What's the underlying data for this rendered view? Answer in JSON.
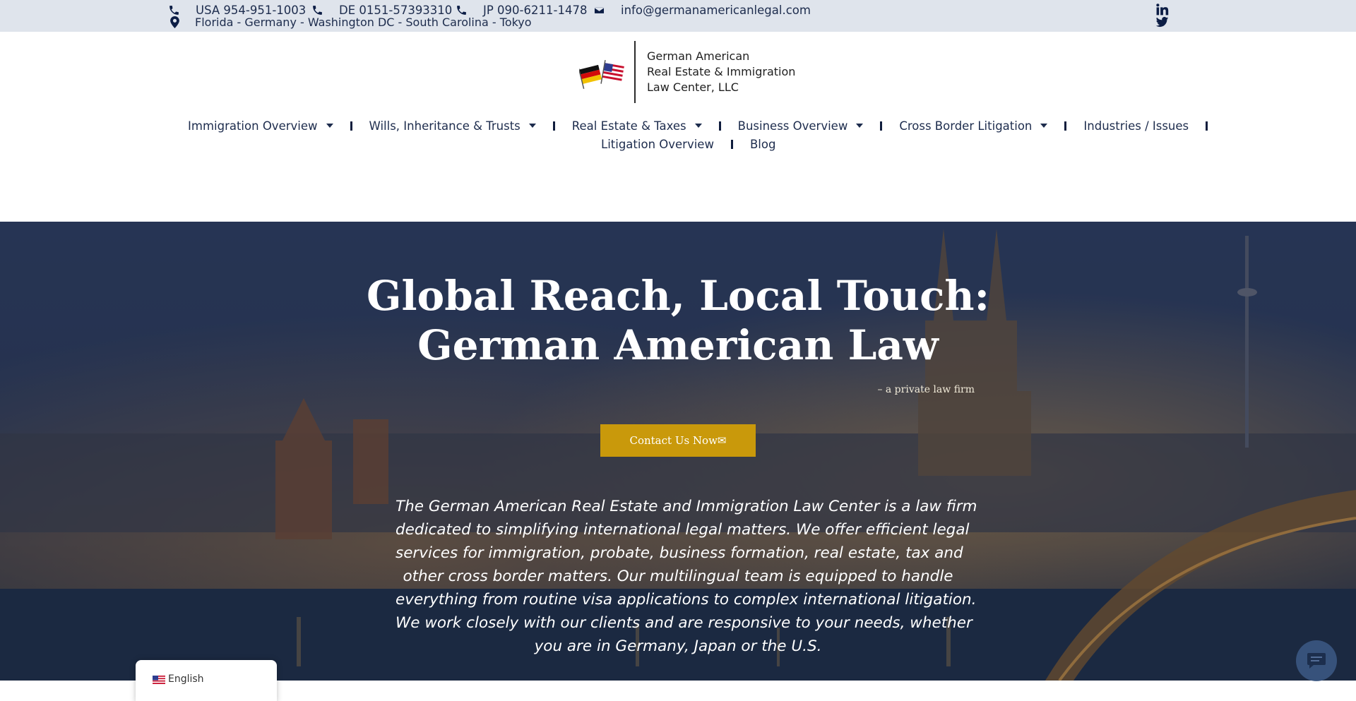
{
  "topbar": {
    "phone_usa": "USA 954-951-1003",
    "phone_de": "DE 0151-57393310",
    "phone_jp": "JP 090-6211-1478",
    "email": "info@germanamericanlegal.com",
    "locations": "Florida - Germany - Washington DC - South Carolina - Tokyo",
    "social": [
      "linkedin-icon",
      "twitter-icon"
    ]
  },
  "logo": {
    "line1": "German American",
    "line2": "Real Estate & Immigration",
    "line3": "Law Center, LLC"
  },
  "nav": {
    "items": [
      {
        "label": "Immigration Overview",
        "dropdown": true
      },
      {
        "label": "Wills, Inheritance & Trusts",
        "dropdown": true
      },
      {
        "label": "Real Estate & Taxes",
        "dropdown": true
      },
      {
        "label": "Business Overview",
        "dropdown": true
      },
      {
        "label": "Cross Border Litigation",
        "dropdown": true
      },
      {
        "label": "Industries / Issues",
        "dropdown": false
      },
      {
        "label": "Litigation Overview",
        "dropdown": false
      },
      {
        "label": "Blog",
        "dropdown": false
      }
    ]
  },
  "hero": {
    "title_line1": "Global Reach, Local Touch:",
    "title_line2": "German American Law",
    "tagline": "– a private law firm",
    "cta_label": "Contact Us Now✉",
    "body_lines": [
      "The German American Real Estate and Immigration Law Center is a law firm",
      "dedicated to simplifying international legal matters. We offer efficient legal",
      "services for immigration, probate, business formation, real estate, tax and",
      "other cross border matters. Our multilingual team is equipped to handle",
      "everything from routine visa applications to complex international litigation.",
      "We work closely with our clients and are responsive to your needs, whether",
      "you are in Germany, Japan or the U.S."
    ]
  },
  "language_switcher": {
    "label": "English",
    "flag": "us-flag-icon"
  },
  "chat": {
    "icon": "chat-icon"
  },
  "colors": {
    "topbar_bg": "#dfe4ec",
    "nav_text": "#1d2c4d",
    "cta_bg": "#c9990b",
    "hero_overlay": "#1e2a45"
  }
}
